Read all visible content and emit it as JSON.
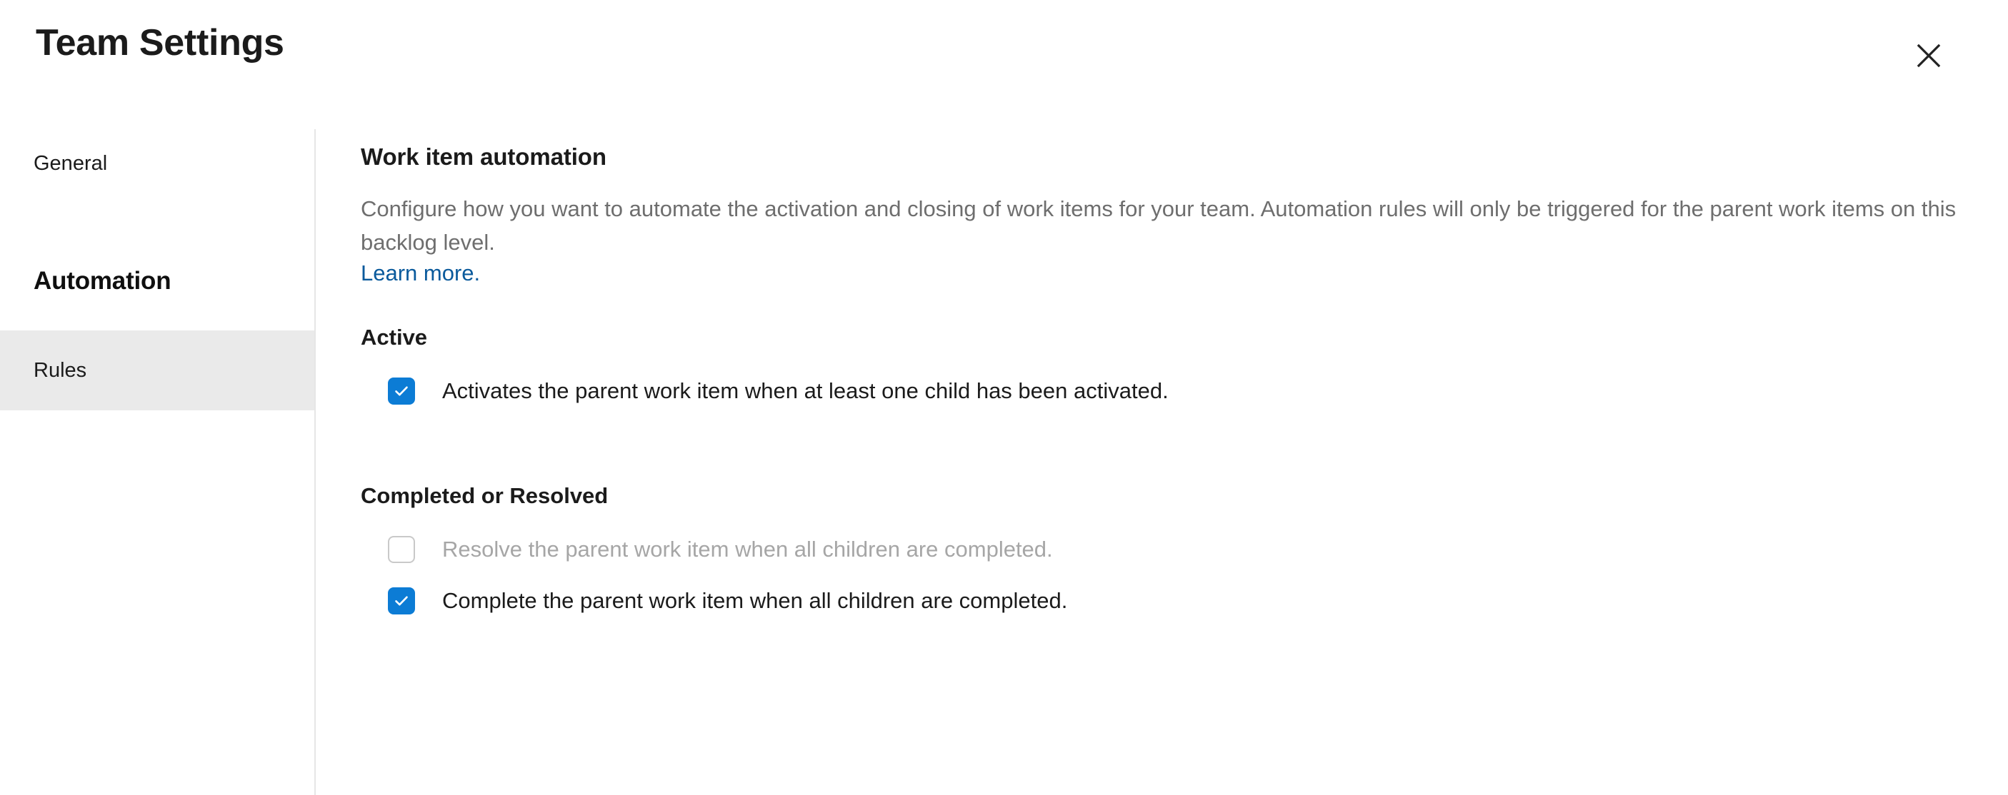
{
  "dialog": {
    "title": "Team Settings",
    "close_icon": "close-icon",
    "close_label": "Close"
  },
  "sidebar": {
    "items": [
      {
        "label": "General",
        "type": "item",
        "selected": false
      },
      {
        "label": "Automation",
        "type": "section-header",
        "selected": false
      },
      {
        "label": "Rules",
        "type": "item",
        "selected": true
      }
    ]
  },
  "main": {
    "heading": "Work item automation",
    "description": "Configure how you want to automate the activation and closing of work items for your team. Automation rules will only be triggered for the parent work items on this backlog level.",
    "learn_more": "Learn more.",
    "groups": [
      {
        "title": "Active",
        "rules": [
          {
            "label": "Activates the parent work item when at least one child has been activated.",
            "checked": true,
            "disabled": false
          }
        ]
      },
      {
        "title": "Completed or Resolved",
        "rules": [
          {
            "label": "Resolve the parent work item when all children are completed.",
            "checked": false,
            "disabled": true
          },
          {
            "label": "Complete the parent work item when all children are completed.",
            "checked": true,
            "disabled": false
          }
        ]
      }
    ]
  },
  "colors": {
    "accent": "#0c7cd5",
    "link": "#0a5a9c",
    "selected_background": "#eaeaea",
    "muted_text": "#6e6e6e",
    "disabled_text": "#a6a6a6",
    "divider": "#e6e6e6"
  }
}
